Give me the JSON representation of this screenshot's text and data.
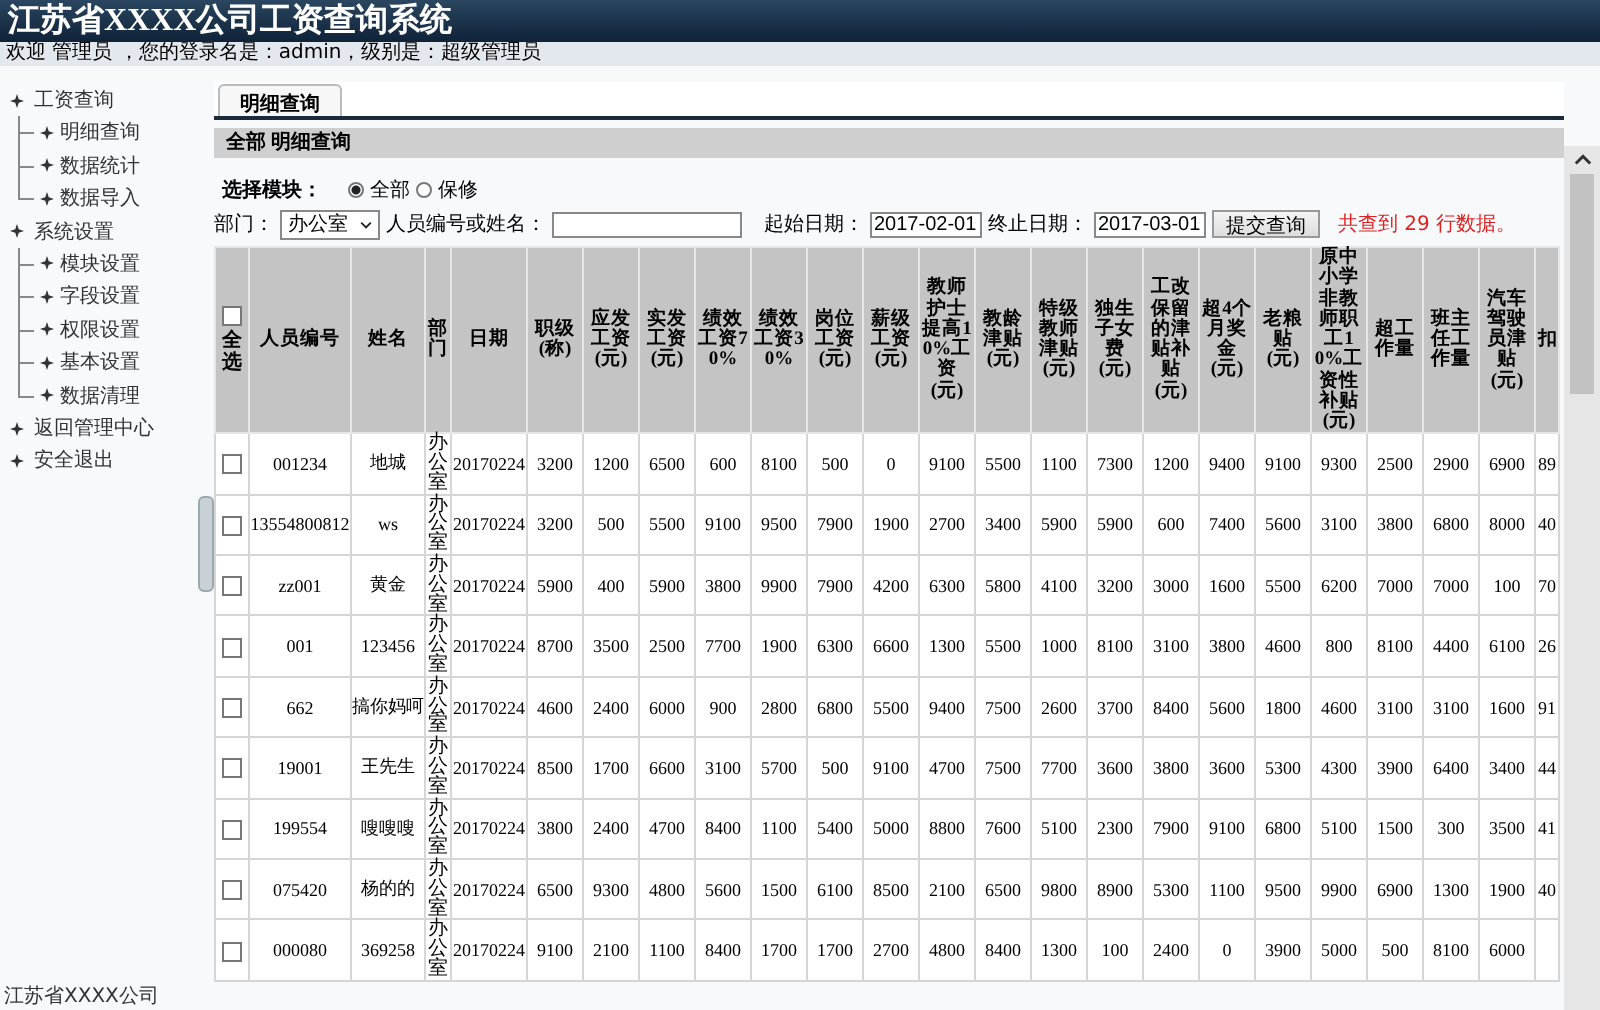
{
  "header": {
    "title": "江苏省XXXX公司工资查询系统",
    "welcome": "欢迎 管理员 ，您的登录名是：admin，级别是：超级管理员"
  },
  "sidebar": {
    "items": [
      {
        "label": "工资查询",
        "children": [
          {
            "label": "明细查询"
          },
          {
            "label": "数据统计"
          },
          {
            "label": "数据导入"
          }
        ]
      },
      {
        "label": "系统设置",
        "children": [
          {
            "label": "模块设置"
          },
          {
            "label": "字段设置"
          },
          {
            "label": "权限设置"
          },
          {
            "label": "基本设置"
          },
          {
            "label": "数据清理"
          }
        ]
      },
      {
        "label": "返回管理中心"
      },
      {
        "label": "安全退出"
      }
    ],
    "footer": "江苏省XXXX公司"
  },
  "tabs": [
    {
      "label": "明细查询",
      "selected": true
    }
  ],
  "breadcrumb": "全部 明细查询",
  "module_filter": {
    "label": "选择模块：",
    "options": [
      {
        "label": "全部",
        "selected": true
      },
      {
        "label": "保修",
        "selected": false
      }
    ]
  },
  "filters": {
    "department_label": "部门：",
    "department": "办公室",
    "person_label": "人员编号或姓名：",
    "start_label": "起始日期：",
    "start_date": "2017-02-01",
    "end_label": "终止日期：",
    "end_date": "2017-03-01",
    "submit": "提交查询",
    "result": "共查到 29 行数据。"
  },
  "table": {
    "select_all": {
      "label": "全选",
      "checked": false
    },
    "columns": [
      "人员编号",
      "姓名",
      "部门",
      "日期",
      "职级(称)",
      "应发工资(元)",
      "实发工资(元)",
      "绩效工资70%",
      "绩效工资30%",
      "岗位工资(元)",
      "薪级工资(元)",
      "教师护士提高10%工资(元)",
      "教龄津贴(元)",
      "特级教师津贴(元)",
      "独生子女费(元)",
      "工改保留的津贴补贴(元)",
      "超4个月奖金(元)",
      "老粮贴(元)",
      "原中小学非教师职工10%工资性补贴(元)",
      "超工作量",
      "班主任工作量",
      "汽车驾驶员津贴(元)",
      "扣"
    ],
    "rows": [
      {
        "checked": false,
        "cells": [
          "001234",
          "地城",
          "办公室",
          "20170224",
          "3200",
          "1200",
          "6500",
          "600",
          "8100",
          "500",
          "0",
          "9100",
          "5500",
          "1100",
          "7300",
          "1200",
          "9400",
          "9100",
          "9300",
          "2500",
          "2900",
          "6900",
          "89"
        ]
      },
      {
        "checked": false,
        "cells": [
          "13554800812",
          "ws",
          "办公室",
          "20170224",
          "3200",
          "500",
          "5500",
          "9100",
          "9500",
          "7900",
          "1900",
          "2700",
          "3400",
          "5900",
          "5900",
          "600",
          "7400",
          "5600",
          "3100",
          "3800",
          "6800",
          "8000",
          "40"
        ]
      },
      {
        "checked": false,
        "cells": [
          "zz001",
          "黄金",
          "办公室",
          "20170224",
          "5900",
          "400",
          "5900",
          "3800",
          "9900",
          "7900",
          "4200",
          "6300",
          "5800",
          "4100",
          "3200",
          "3000",
          "1600",
          "5500",
          "6200",
          "7000",
          "7000",
          "100",
          "70"
        ]
      },
      {
        "checked": false,
        "cells": [
          "001",
          "123456",
          "办公室",
          "20170224",
          "8700",
          "3500",
          "2500",
          "7700",
          "1900",
          "6300",
          "6600",
          "1300",
          "5500",
          "1000",
          "8100",
          "3100",
          "3800",
          "4600",
          "800",
          "8100",
          "4400",
          "6100",
          "26"
        ]
      },
      {
        "checked": false,
        "cells": [
          "662",
          "搞你妈呵",
          "办公室",
          "20170224",
          "4600",
          "2400",
          "6000",
          "900",
          "2800",
          "6800",
          "5500",
          "9400",
          "7500",
          "2600",
          "3700",
          "8400",
          "5600",
          "1800",
          "4600",
          "3100",
          "3100",
          "1600",
          "91"
        ]
      },
      {
        "checked": false,
        "cells": [
          "19001",
          "王先生",
          "办公室",
          "20170224",
          "8500",
          "1700",
          "6600",
          "3100",
          "5700",
          "500",
          "9100",
          "4700",
          "7500",
          "7700",
          "3600",
          "3800",
          "3600",
          "5300",
          "4300",
          "3900",
          "6400",
          "3400",
          "44"
        ]
      },
      {
        "checked": false,
        "cells": [
          "199554",
          "嗖嗖嗖",
          "办公室",
          "20170224",
          "3800",
          "2400",
          "4700",
          "8400",
          "1100",
          "5400",
          "5000",
          "8800",
          "7600",
          "5100",
          "2300",
          "7900",
          "9100",
          "6800",
          "5100",
          "1500",
          "300",
          "3500",
          "41"
        ]
      },
      {
        "checked": false,
        "cells": [
          "075420",
          "杨的的",
          "办公室",
          "20170224",
          "6500",
          "9300",
          "4800",
          "5600",
          "1500",
          "6100",
          "8500",
          "2100",
          "6500",
          "9800",
          "8900",
          "5300",
          "1100",
          "9500",
          "9900",
          "6900",
          "1300",
          "1900",
          "40"
        ]
      },
      {
        "checked": false,
        "cells": [
          "000080",
          "369258",
          "办公室",
          "20170224",
          "9100",
          "2100",
          "1100",
          "8400",
          "1700",
          "1700",
          "2700",
          "4800",
          "8400",
          "1300",
          "100",
          "2400",
          "0",
          "3900",
          "5000",
          "500",
          "8100",
          "6000"
        ]
      }
    ]
  }
}
